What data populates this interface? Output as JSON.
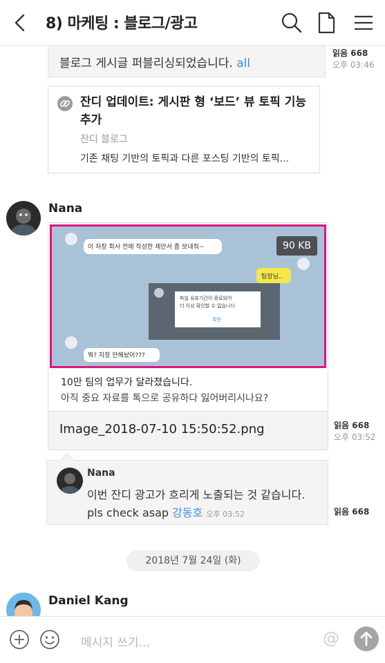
{
  "header": {
    "title": "8) 마케팅 : 블로그/광고"
  },
  "messages": {
    "top_bubble": {
      "text": "블로그 게시글 퍼블리싱되었습니다.",
      "link_text": "all",
      "read": "읽음 668",
      "time": "오후 03:46"
    },
    "link_card": {
      "title": "잔디 업데이트: 게시판 형 ‘보드’ 뷰 토픽 기능 추가",
      "source": "잔디 블로그",
      "description": "기존 채팅 기반의 토픽과 다른 포스팅 기반의 토픽..."
    },
    "image_message": {
      "sender": "Nana",
      "size": "90 KB",
      "caption1": "10만 팀의 업무가 달라졌습니다.",
      "caption2": "아직 중요 자료를 톡으로 공유하다 잃어버리시나요?",
      "file_name": "Image_2018-07-10 15:50:52.png",
      "read": "읽음 668",
      "time": "오후 03:52",
      "thumb_texts": {
        "bubble1": "이 차장 회사 전에 작성한 제안서 좀 보내줘~",
        "bubble2": "팀장님..",
        "dialog1": "파일 유효기간이 종료되어",
        "dialog2": "더 이상 확인할 수 없습니다.",
        "dialog_btn": "확인",
        "bubble3": "뭐? 지장 안해놨어???"
      }
    },
    "reply": {
      "sender": "Nana",
      "line1": "이번 잔디 광고가 흐리게 노출되는 것 같습니다.",
      "line2": "pls check asap",
      "mention": "강동호",
      "time": "오후 03:52",
      "read": "읽음 668"
    },
    "date_divider": "2018년 7월 24일 (화)",
    "next_sender": "Daniel Kang"
  },
  "input": {
    "placeholder": "메시지 쓰기...",
    "at_symbol": "@"
  },
  "colors": {
    "link": "#3b8fe8",
    "thumb_border": "#e0157d",
    "thumb_bg": "#a9c2d7"
  }
}
